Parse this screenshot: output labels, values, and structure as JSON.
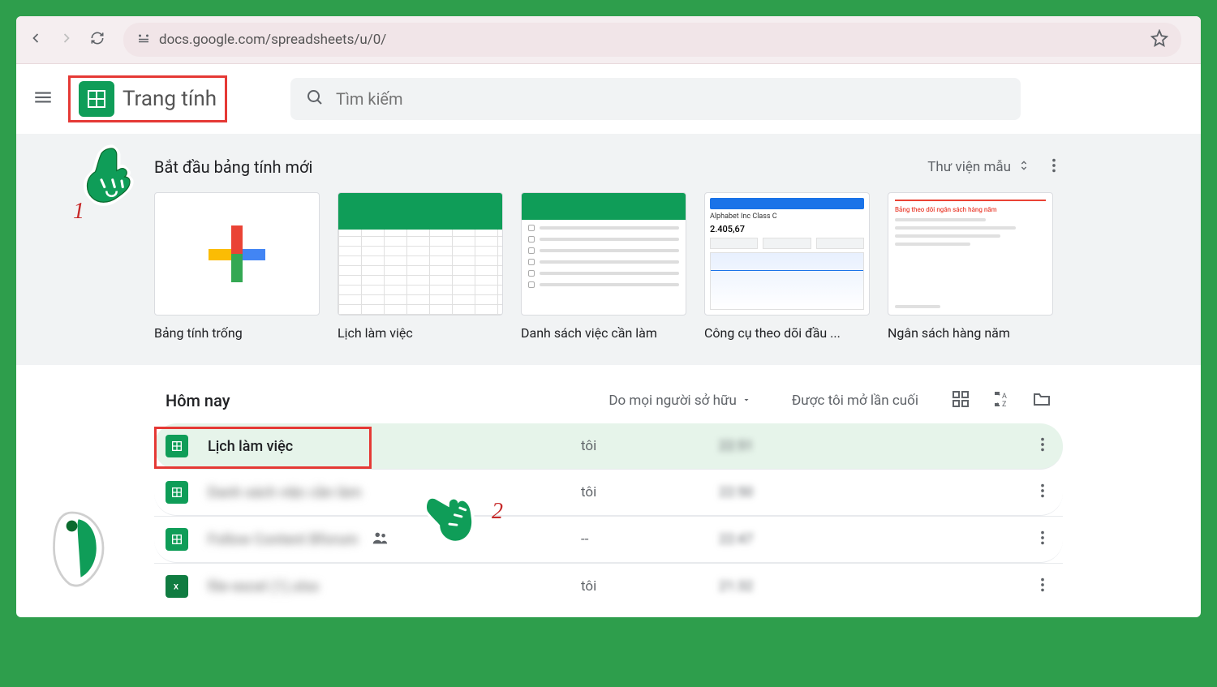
{
  "browser": {
    "url": "docs.google.com/spreadsheets/u/0/"
  },
  "app": {
    "title": "Trang tính",
    "search_placeholder": "Tìm kiếm"
  },
  "templates": {
    "heading": "Bắt đầu bảng tính mới",
    "gallery_label": "Thư viện mẫu",
    "items": [
      {
        "label": "Bảng tính trống"
      },
      {
        "label": "Lịch làm việc"
      },
      {
        "label": "Danh sách việc cần làm"
      },
      {
        "label": "Công cụ theo dõi đầu ..."
      },
      {
        "label": "Ngân sách hàng năm"
      }
    ],
    "invest_card": {
      "line1": "Alphabet Inc Class C",
      "line2": "2.405,67"
    },
    "budget_card_title": "Bảng theo dõi ngân sách hàng năm"
  },
  "doclist": {
    "section": "Hôm nay",
    "owner_filter": "Do mọi người sở hữu",
    "last_open": "Được tôi mở lần cuối",
    "rows": [
      {
        "name": "Lịch làm việc",
        "owner": "tôi",
        "time": "22:51",
        "shared": false,
        "highlight": true,
        "blurname": false,
        "type": "sheets"
      },
      {
        "name": "Danh sách việc cần làm",
        "owner": "tôi",
        "time": "22:50",
        "shared": false,
        "highlight": false,
        "blurname": true,
        "type": "sheets"
      },
      {
        "name": "Follow Content Bforum",
        "owner": "--",
        "time": "22:47",
        "shared": true,
        "highlight": false,
        "blurname": true,
        "type": "sheets"
      },
      {
        "name": "file-excel (1).xlsx",
        "owner": "tôi",
        "time": "21:32",
        "shared": false,
        "highlight": false,
        "blurname": true,
        "type": "excel"
      }
    ]
  },
  "annotations": {
    "n1": "1",
    "n2": "2"
  }
}
